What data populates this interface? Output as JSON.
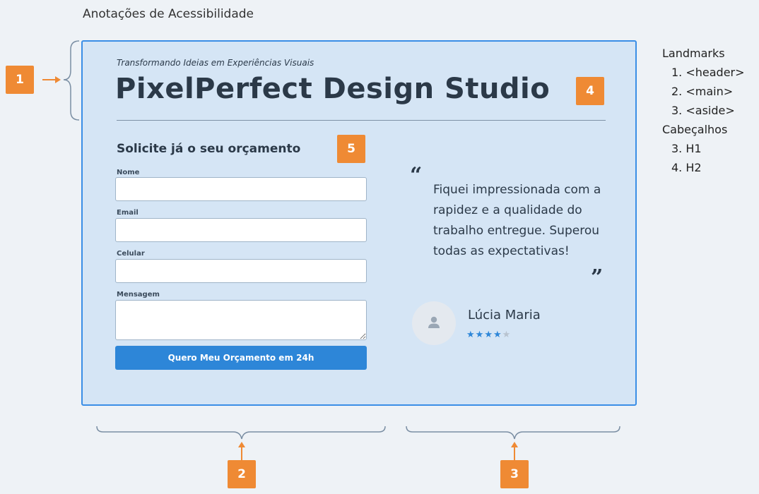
{
  "page_heading": "Anotações de Acessibilidade",
  "header": {
    "tagline": "Transformando Ideias em Experiências Visuais",
    "title": "PixelPerfect Design Studio"
  },
  "form": {
    "heading": "Solicite já o seu orçamento",
    "fields": [
      {
        "label": "Nome",
        "value": ""
      },
      {
        "label": "Email",
        "value": ""
      },
      {
        "label": "Celular",
        "value": ""
      },
      {
        "label": "Mensagem",
        "value": ""
      }
    ],
    "submit_label": "Quero Meu Orçamento em 24h"
  },
  "testimonial": {
    "open_quote": "“",
    "close_quote": "”",
    "quote": "Fiquei impressionada com a rapidez e a qualidade do trabalho entregue. Superou todas as expectativas!",
    "author": "Lúcia Maria",
    "rating": 4,
    "rating_max": 5,
    "avatar_icon": "user-icon"
  },
  "badges": {
    "b1": "1",
    "b2": "2",
    "b3": "3",
    "b4": "4",
    "b5": "5"
  },
  "legend": {
    "landmarks_title": "Landmarks",
    "landmarks": [
      "1. <header>",
      "2. <main>",
      "3. <aside>"
    ],
    "headings_title": "Cabeçalhos",
    "headings": [
      "3. H1",
      "4. H2"
    ]
  },
  "colors": {
    "badge": "#ef8a34",
    "card_background": "#d5e5f5",
    "card_border": "#3a8ee6",
    "button": "#2d86d8",
    "star_on": "#2d86d8",
    "star_off": "#b8c3cf"
  }
}
